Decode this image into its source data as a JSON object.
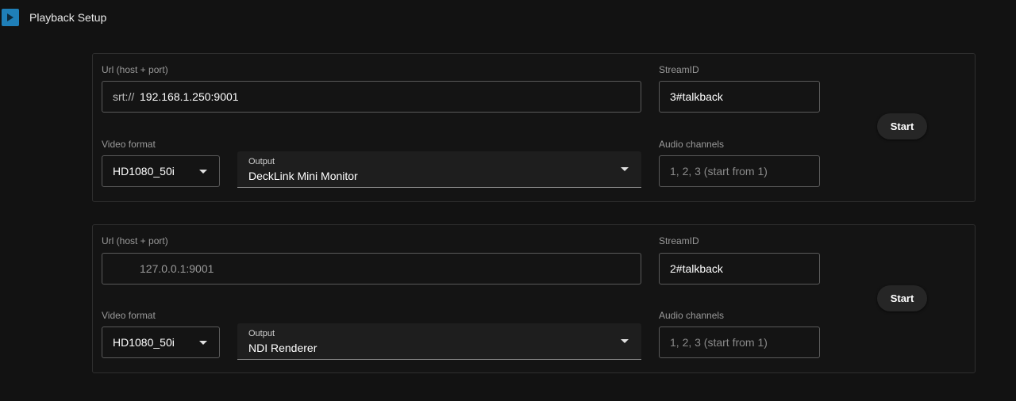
{
  "header": {
    "title": "Playback Setup",
    "icon": "play-icon",
    "icon_color": "#1f7fb8"
  },
  "cards": [
    {
      "url_label": "Url (host + port)",
      "url_prefix": "srt://",
      "url_value": "192.168.1.250:9001",
      "streamid_label": "StreamID",
      "streamid_value": "3#talkback",
      "video_format_label": "Video format",
      "video_format_value": "HD1080_50i",
      "output_label": "Output",
      "output_value": "DeckLink Mini Monitor",
      "audio_label": "Audio channels",
      "audio_placeholder": "1, 2, 3 (start from 1)",
      "start_label": "Start"
    },
    {
      "url_label": "Url (host + port)",
      "url_prefix": "",
      "url_value": "127.0.0.1:9001",
      "streamid_label": "StreamID",
      "streamid_value": "2#talkback",
      "video_format_label": "Video format",
      "video_format_value": "HD1080_50i",
      "output_label": "Output",
      "output_value": "NDI Renderer",
      "audio_label": "Audio channels",
      "audio_placeholder": "1, 2, 3 (start from 1)",
      "start_label": "Start"
    }
  ]
}
